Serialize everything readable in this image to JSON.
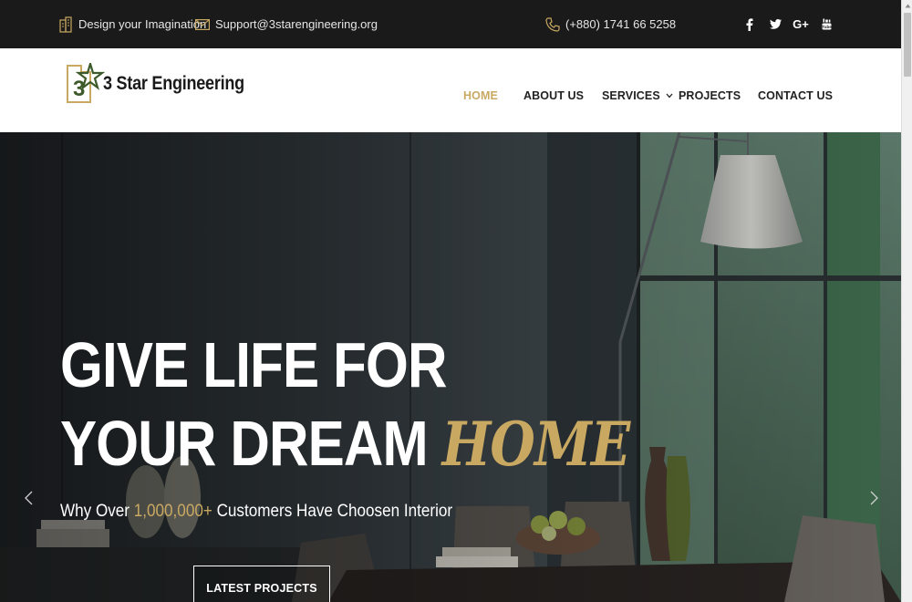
{
  "topbar": {
    "tagline": "Design your Imagination",
    "email": "Support@3starengineering.org",
    "phone": "(+880) 1741 66 5258",
    "social": [
      "facebook-icon",
      "twitter-icon",
      "google-plus-icon",
      "youtube-icon"
    ],
    "google_plus_label": "G+"
  },
  "header": {
    "logo_text": "3 Star Engineering",
    "logo_glyph": "3",
    "nav": {
      "home": "HOME",
      "about": "ABOUT US",
      "services": "SERVICES",
      "projects": "PROJECTS",
      "contact": "CONTACT US"
    },
    "active_item": "HOME"
  },
  "hero": {
    "title_line1": "GIVE LIFE FOR",
    "title_line2": "YOUR DREAM ",
    "title_accent": "HOME",
    "subtitle_before": "Why Over ",
    "subtitle_number": "1,000,000+",
    "subtitle_after": " Customers Have Choosen Interior",
    "button_label": "LATEST PROJECTS"
  },
  "colors": {
    "accent": "#c9a962",
    "topbar_bg": "#1a1a1a",
    "logo_green": "#3d5a2a"
  }
}
